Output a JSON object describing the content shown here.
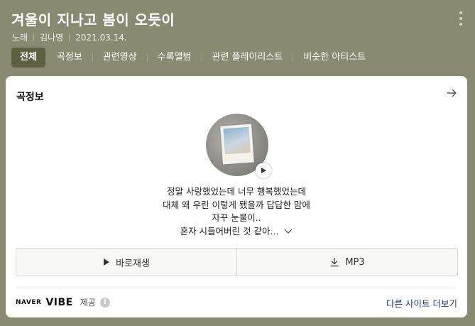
{
  "header": {
    "title": "겨울이 지나고 봄이 오듯이",
    "meta": [
      "노래",
      "김나영",
      "2021.03.14."
    ]
  },
  "tabs": [
    "전체",
    "곡정보",
    "관련영상",
    "수록앨범",
    "관련 플레이리스트",
    "비슷한 아티스트"
  ],
  "card": {
    "title": "곡정보",
    "lyrics": [
      "정말 사랑했었는데 너무 행복했었는데",
      "대체 왜 우린 이렇게 됐을까 답답한 맘에",
      "자꾸 눈물이..",
      "혼자 시들어버린 것 같아..."
    ],
    "play_label": "바로재생",
    "mp3_label": "MP3",
    "provider_naver": "NAVER",
    "provider_vibe": "VIBE",
    "provider_suffix": "제공",
    "more_sites": "다른 사이트 더보기"
  },
  "colors": {
    "header_bg": "#8a8a73",
    "active_tab": "#5d6141",
    "link": "#1a3a8a"
  },
  "icons": [
    "more-vertical-icon",
    "arrow-right-icon",
    "play-icon",
    "chevron-down-icon",
    "download-icon",
    "info-icon"
  ]
}
